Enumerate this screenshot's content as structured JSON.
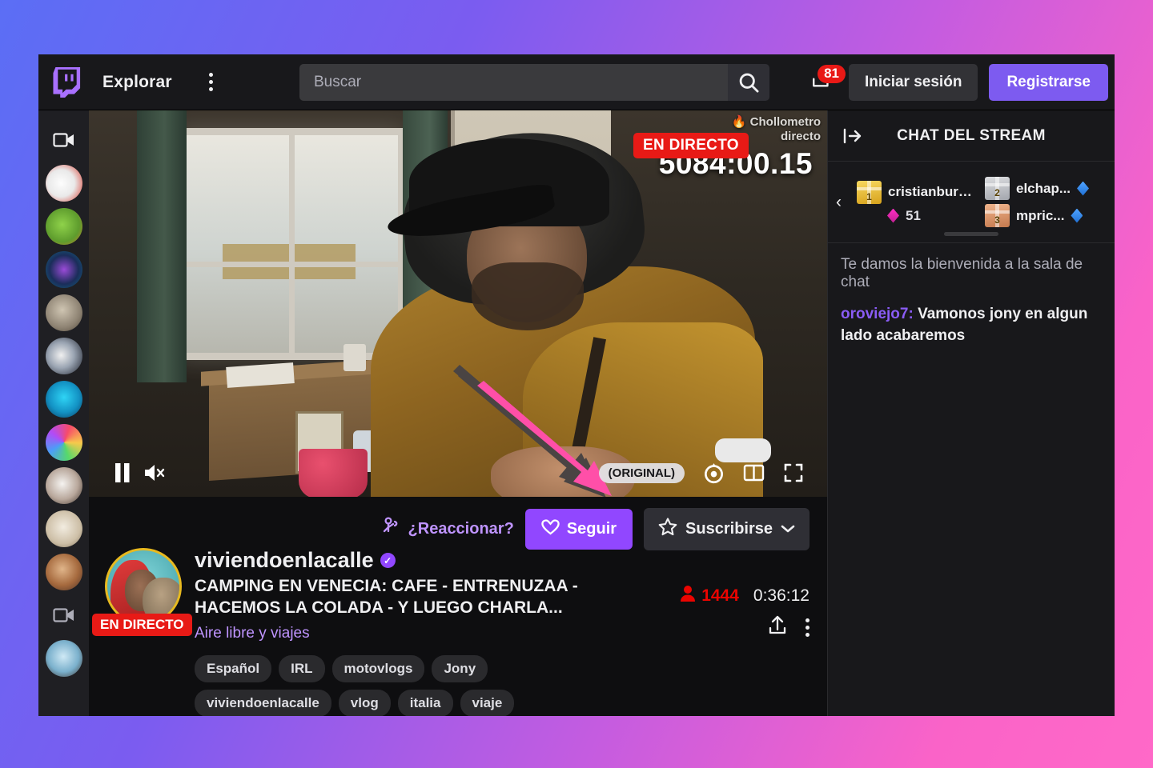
{
  "navbar": {
    "logo_icon": "twitch-logo-icon",
    "explore_label": "Explorar",
    "kebab_icon": "more-vertical-icon",
    "search": {
      "placeholder": "Buscar",
      "value": "",
      "icon": "search-icon"
    },
    "prime": {
      "icon": "prime-crown-icon",
      "badge_count": "81"
    },
    "login_label": "Iniciar sesión",
    "signup_label": "Registrarse"
  },
  "sidebar": {
    "top_icon": "video-camera-icon",
    "bottom_icon": "video-camera-icon",
    "items": [
      {
        "name": "channel-avatar-1"
      },
      {
        "name": "channel-avatar-2"
      },
      {
        "name": "channel-avatar-3"
      },
      {
        "name": "channel-avatar-4"
      },
      {
        "name": "channel-avatar-5"
      },
      {
        "name": "channel-avatar-6"
      },
      {
        "name": "channel-avatar-7"
      },
      {
        "name": "channel-avatar-8"
      },
      {
        "name": "channel-avatar-9"
      },
      {
        "name": "channel-avatar-10"
      }
    ]
  },
  "player": {
    "live_badge": "EN DIRECTO",
    "watermark_line1": "Chollometro",
    "watermark_line2": "directo",
    "timer_overlay": "5084:00.15",
    "pause_icon": "pause-icon",
    "mute_icon": "volume-muted-icon",
    "quality_label": "(ORIGINAL)",
    "settings_icon": "gear-icon",
    "theater_icon": "theater-mode-icon",
    "fullscreen_icon": "fullscreen-icon",
    "annotation_icon": "pink-arrow-annotation"
  },
  "channel": {
    "react_label": "¿Reaccionar?",
    "react_icon": "reaction-person-icon",
    "follow_label": "Seguir",
    "follow_icon": "heart-icon",
    "subscribe_label": "Suscribirse",
    "subscribe_icon": "star-icon",
    "subscribe_chevron_icon": "chevron-down-icon",
    "live_badge": "EN DIRECTO",
    "avatar_name": "channel-avatar",
    "name": "viviendoenlacalle",
    "verified_icon": "verified-check-icon",
    "title": "CAMPING EN VENECIA: CAFE - ENTRENUZAA - HACEMOS LA COLADA - Y LUEGO CHARLA...",
    "category": "Aire libre y viajes",
    "viewer_icon": "viewer-person-icon",
    "viewer_count": "1444",
    "uptime": "0:36:12",
    "share_icon": "share-upload-icon",
    "more_icon": "more-vertical-icon",
    "tags": [
      "Español",
      "IRL",
      "motovlogs",
      "Jony",
      "viviendoenlacalle",
      "vlog",
      "italia",
      "viaje"
    ]
  },
  "chat": {
    "collapse_icon": "collapse-chat-icon",
    "title": "CHAT DEL STREAM",
    "leaderboard": {
      "prev_icon": "chevron-left-icon",
      "entries_left": [
        {
          "rank": "1",
          "user": "cristianburgos...",
          "value": "51",
          "currency_icon": "bits-icon-pink"
        }
      ],
      "entries_right": [
        {
          "rank": "2",
          "user": "elchap...",
          "value": "",
          "currency_icon": "bits-icon-blue"
        },
        {
          "rank": "3",
          "user": "mpric...",
          "value": "",
          "currency_icon": "bits-icon-blue"
        }
      ]
    },
    "welcome_message": "Te damos la bienvenida a la sala de chat",
    "messages": [
      {
        "user": "oroviejo7",
        "separator": ": ",
        "text": "Vamonos jony en algun lado acabaremos"
      }
    ]
  },
  "colors": {
    "twitch_purple": "#9147ff",
    "live_red": "#e81a16",
    "accent_lavender": "#bf94ff",
    "bg_dark": "#0e0e10",
    "bg_panel": "#18181b"
  }
}
